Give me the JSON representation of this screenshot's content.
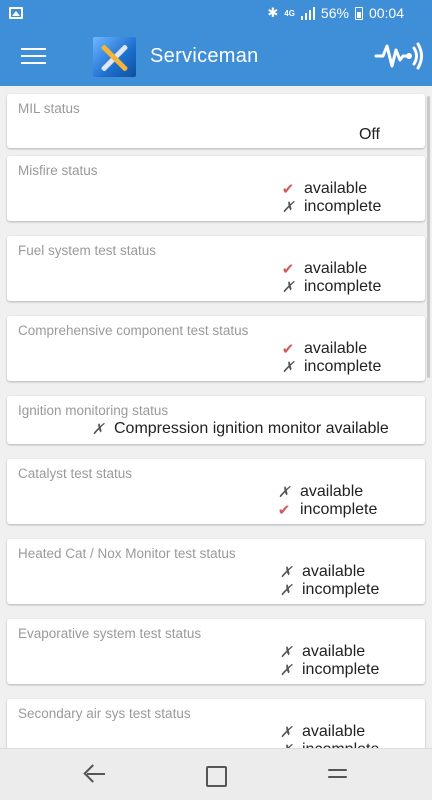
{
  "status_bar": {
    "network": "4G",
    "battery": "56%",
    "time": "00:04"
  },
  "app_bar": {
    "title": "Serviceman"
  },
  "cards": [
    {
      "title": "MIL status",
      "value": "Off"
    },
    {
      "title": "Misfire status",
      "available": "available",
      "incomplete": "incomplete",
      "available_mark": "✔",
      "incomplete_mark": "✗"
    },
    {
      "title": "Fuel system test status",
      "available": "available",
      "incomplete": "incomplete",
      "available_mark": "✔",
      "incomplete_mark": "✗"
    },
    {
      "title": "Comprehensive component test status",
      "available": "available",
      "incomplete": "incomplete",
      "available_mark": "✔",
      "incomplete_mark": "✗"
    },
    {
      "title": "Ignition monitoring status",
      "text": "Compression ignition monitor available",
      "mark": "✗"
    },
    {
      "title": "Catalyst test status",
      "available": "available",
      "incomplete": "incomplete",
      "available_mark": "✗",
      "incomplete_mark": "✔"
    },
    {
      "title": "Heated Cat / Nox Monitor test status",
      "available": "available",
      "incomplete": "incomplete",
      "available_mark": "✗",
      "incomplete_mark": "✗"
    },
    {
      "title": "Evaporative system test status",
      "available": "available",
      "incomplete": "incomplete",
      "available_mark": "✗",
      "incomplete_mark": "✗"
    },
    {
      "title": "Secondary air sys test status",
      "available": "available",
      "incomplete": "incomplete",
      "available_mark": "✗",
      "incomplete_mark": "✗"
    }
  ],
  "colors": {
    "primary": "#3f8ed8",
    "check": "#d45a5a",
    "cross": "#555555"
  }
}
